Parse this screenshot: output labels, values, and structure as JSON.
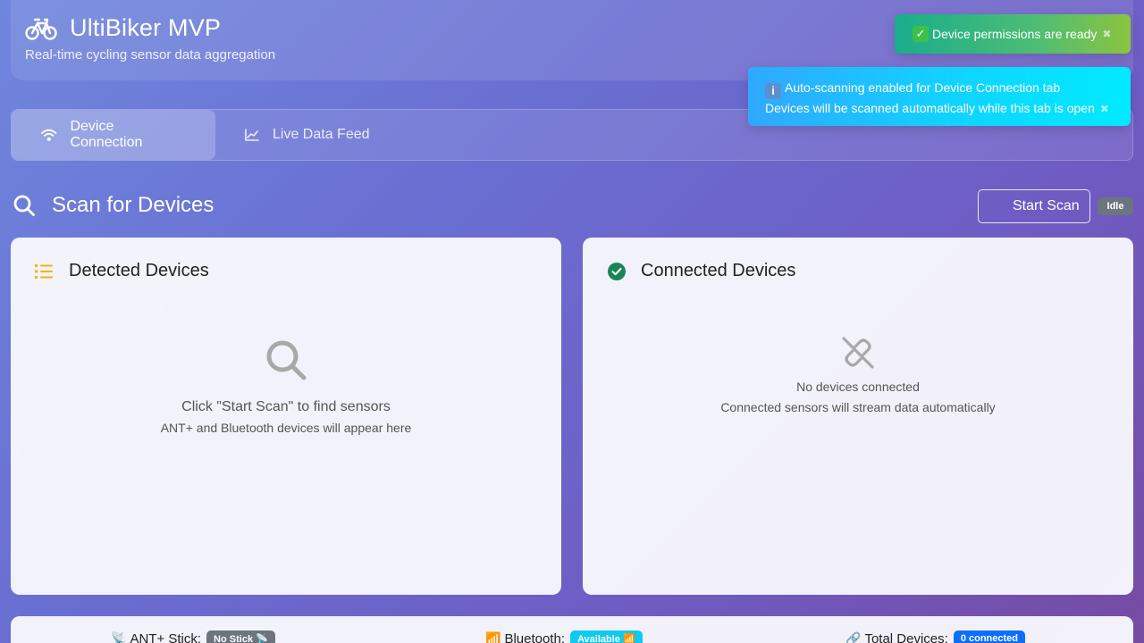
{
  "header": {
    "title": "UltiBiker MVP",
    "subtitle": "Real-time cycling sensor data aggregation",
    "icon": "bicycle-icon"
  },
  "tabs": [
    {
      "label": "Device Connection",
      "icon": "wifi-icon",
      "active": true
    },
    {
      "label": "Live Data Feed",
      "icon": "chart-line-icon",
      "active": false
    }
  ],
  "toasts": {
    "success": {
      "text": "Device permissions are ready",
      "close": "✖",
      "color": "#19ad8c"
    },
    "info": {
      "line1": "Auto-scanning enabled for Device Connection tab",
      "line2": "Devices will be scanned automatically while this tab is open",
      "close": "✖",
      "color": "#10d4ff"
    }
  },
  "scan": {
    "title": "Scan for Devices",
    "button_label": "Start Scan",
    "status": "Idle"
  },
  "detected": {
    "title": "Detected Devices",
    "empty_title": "Click \"Start Scan\" to find sensors",
    "empty_sub": "ANT+ and Bluetooth devices will appear here"
  },
  "connected": {
    "title": "Connected Devices",
    "empty_title": "No devices connected",
    "empty_sub": "Connected sensors will stream data automatically"
  },
  "status_bar": {
    "ant": {
      "label": "ANT+ Stick:",
      "value": "No Stick 📡"
    },
    "bluetooth": {
      "label": "Bluetooth:",
      "value": "Available 📶"
    },
    "total": {
      "label": "Total Devices:",
      "value": "0 connected"
    }
  },
  "colors": {
    "accent_yellow": "#f4b400",
    "success_green": "#198754",
    "badge_grey": "#6c757d",
    "badge_cyan": "#0dcaf0",
    "badge_blue": "#0d6efd"
  }
}
